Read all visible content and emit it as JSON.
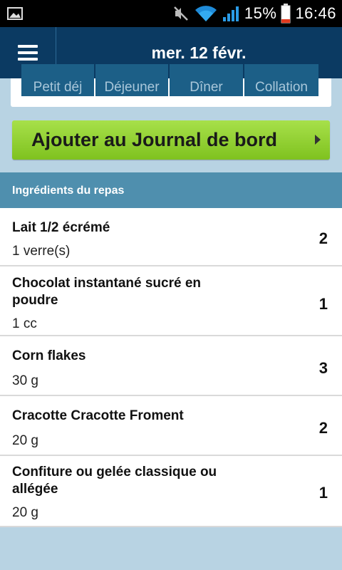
{
  "status_bar": {
    "battery_percent": "15%",
    "time": "16:46",
    "icons": [
      "image-icon",
      "mute-icon",
      "wifi-icon",
      "signal-icon",
      "battery-icon"
    ]
  },
  "header": {
    "menu_icon": "hamburger-icon",
    "date": "mer. 12 févr."
  },
  "meal_tabs": [
    {
      "label": "Petit déj"
    },
    {
      "label": "Déjeuner"
    },
    {
      "label": "Dîner"
    },
    {
      "label": "Collation"
    }
  ],
  "add_button": {
    "label": "Ajouter au Journal de bord"
  },
  "ingredients_section": {
    "title": "Ingrédients du repas",
    "items": [
      {
        "name": "Lait 1/2 écrémé",
        "portion": "1 verre(s)",
        "qty": "2"
      },
      {
        "name": "Chocolat instantané sucré en poudre",
        "portion": "1 cc",
        "qty": "1"
      },
      {
        "name": "Corn flakes",
        "portion": "30 g",
        "qty": "3"
      },
      {
        "name": "Cracotte  Cracotte Froment",
        "portion": "20 g",
        "qty": "2"
      },
      {
        "name": "Confiture ou gelée classique ou allégée",
        "portion": "20 g",
        "qty": "1"
      }
    ]
  },
  "colors": {
    "header_bg": "#0b3a62",
    "tab_bg": "#1c5f87",
    "button_green": "#8ccf2c",
    "section_header_bg": "#4f8fae",
    "page_bg": "#b8d3e3"
  }
}
